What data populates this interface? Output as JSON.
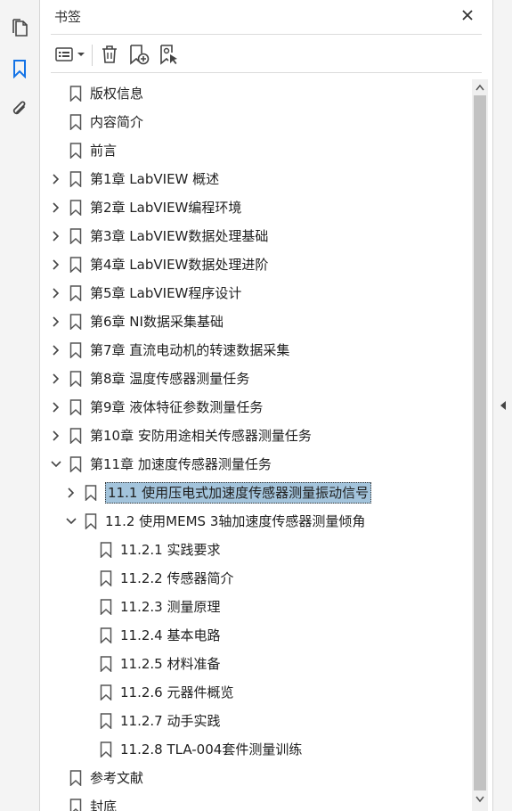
{
  "panel": {
    "title": "书签"
  },
  "left_rail": {
    "icons": [
      "pages-icon",
      "bookmark-icon",
      "attachment-icon"
    ]
  },
  "toolbar": {
    "icons": [
      "options-menu-icon",
      "delete-icon",
      "new-bookmark-icon",
      "bookmark-from-structure-icon"
    ]
  },
  "colors": {
    "selected_bg": "#a3c4dc",
    "accent": "#1473e6",
    "icon": "#444444"
  },
  "bookmarks": [
    {
      "label": "版权信息",
      "level": 0,
      "chevron": "none"
    },
    {
      "label": "内容简介",
      "level": 0,
      "chevron": "none"
    },
    {
      "label": "前言",
      "level": 0,
      "chevron": "none"
    },
    {
      "label": "第1章 LabVIEW 概述",
      "level": 0,
      "chevron": "right"
    },
    {
      "label": "第2章 LabVIEW编程环境",
      "level": 0,
      "chevron": "right"
    },
    {
      "label": "第3章 LabVIEW数据处理基础",
      "level": 0,
      "chevron": "right"
    },
    {
      "label": "第4章 LabVIEW数据处理进阶",
      "level": 0,
      "chevron": "right"
    },
    {
      "label": "第5章 LabVIEW程序设计",
      "level": 0,
      "chevron": "right"
    },
    {
      "label": "第6章 NI数据采集基础",
      "level": 0,
      "chevron": "right"
    },
    {
      "label": "第7章 直流电动机的转速数据采集",
      "level": 0,
      "chevron": "right"
    },
    {
      "label": "第8章 温度传感器测量任务",
      "level": 0,
      "chevron": "right"
    },
    {
      "label": "第9章 液体特征参数测量任务",
      "level": 0,
      "chevron": "right"
    },
    {
      "label": "第10章 安防用途相关传感器测量任务",
      "level": 0,
      "chevron": "right"
    },
    {
      "label": "第11章 加速度传感器测量任务",
      "level": 0,
      "chevron": "down"
    },
    {
      "label": "11.1 使用压电式加速度传感器测量振动信号",
      "level": 1,
      "chevron": "right",
      "selected": true
    },
    {
      "label": "11.2 使用MEMS 3轴加速度传感器测量倾角",
      "level": 1,
      "chevron": "down"
    },
    {
      "label": "11.2.1 实践要求",
      "level": 2,
      "chevron": "none"
    },
    {
      "label": "11.2.2 传感器简介",
      "level": 2,
      "chevron": "none"
    },
    {
      "label": "11.2.3 测量原理",
      "level": 2,
      "chevron": "none"
    },
    {
      "label": "11.2.4 基本电路",
      "level": 2,
      "chevron": "none"
    },
    {
      "label": "11.2.5 材料准备",
      "level": 2,
      "chevron": "none"
    },
    {
      "label": "11.2.6 元器件概览",
      "level": 2,
      "chevron": "none"
    },
    {
      "label": "11.2.7 动手实践",
      "level": 2,
      "chevron": "none"
    },
    {
      "label": "11.2.8 TLA-004套件测量训练",
      "level": 2,
      "chevron": "none"
    },
    {
      "label": "参考文献",
      "level": 0,
      "chevron": "none"
    },
    {
      "label": "封底",
      "level": 0,
      "chevron": "none"
    }
  ]
}
